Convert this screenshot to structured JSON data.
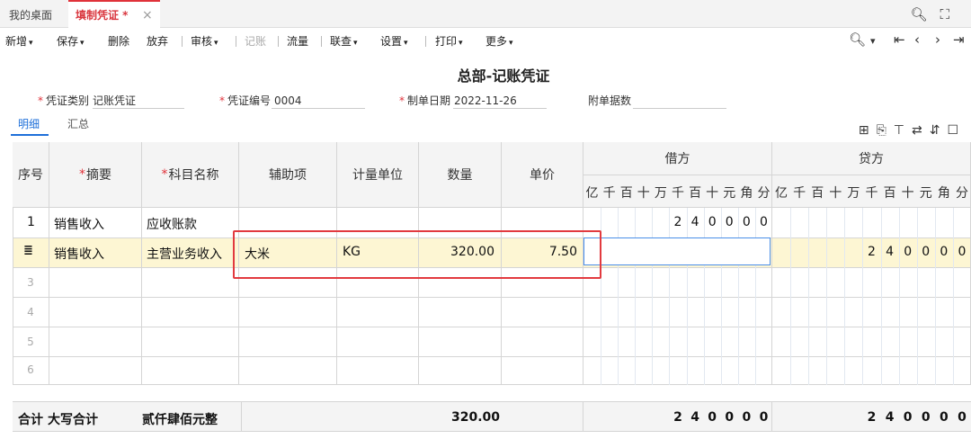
{
  "tabs": {
    "home": "我的桌面",
    "active": "填制凭证 *",
    "close": "×"
  },
  "window_controls": {
    "search": "search-icon",
    "maximize": "maximize-icon"
  },
  "toolbar": {
    "items": [
      {
        "label": "新增",
        "dropdown": true
      },
      {
        "label": "保存",
        "dropdown": true
      },
      {
        "label": "删除",
        "dropdown": false
      },
      {
        "label": "放弃",
        "dropdown": false
      },
      {
        "label": "审核",
        "dropdown": true
      },
      {
        "label": "记账",
        "dropdown": false,
        "disabled": true
      },
      {
        "label": "流量",
        "dropdown": false
      },
      {
        "label": "联查",
        "dropdown": true
      },
      {
        "label": "设置",
        "dropdown": true
      },
      {
        "label": "打印",
        "dropdown": true
      },
      {
        "label": "更多",
        "dropdown": true
      }
    ],
    "caret": "▾"
  },
  "voucher": {
    "title": "总部-记账凭证",
    "type_label": "凭证类别",
    "type_value": "记账凭证",
    "number_label": "凭证编号",
    "number_value": "0004",
    "date_label": "制单日期",
    "date_value": "2022-11-26",
    "attach_label": "附单据数",
    "attach_value": "",
    "required_mark": "*"
  },
  "subtabs": {
    "detail": "明细",
    "summary": "汇总"
  },
  "grid": {
    "headers": {
      "seq": "序号",
      "summary": "摘要",
      "account": "科目名称",
      "aux": "辅助项",
      "unit": "计量单位",
      "qty": "数量",
      "price": "单价",
      "debit": "借方",
      "credit": "贷方"
    },
    "units": [
      "亿",
      "千",
      "百",
      "十",
      "万",
      "千",
      "百",
      "十",
      "元",
      "角",
      "分"
    ],
    "rows": [
      {
        "no": "1",
        "summary": "销售收入",
        "account": "应收账款",
        "aux": "",
        "unit": "",
        "qty": "",
        "price": "",
        "debit_digits": [
          "",
          "",
          "",
          "",
          "",
          "2",
          "4",
          "0",
          "0",
          "0",
          "0"
        ],
        "credit_digits": [
          "",
          "",
          "",
          "",
          "",
          "",
          "",
          "",
          "",
          "",
          ""
        ]
      },
      {
        "no": "",
        "summary": "销售收入",
        "account": "主营业务收入",
        "aux": "大米",
        "unit": "KG",
        "qty": "320.00",
        "price": "7.50",
        "debit_digits": [
          "",
          "",
          "",
          "",
          "",
          "",
          "",
          "",
          "",
          "",
          ""
        ],
        "credit_digits": [
          "",
          "",
          "",
          "",
          "",
          "2",
          "4",
          "0",
          "0",
          "0",
          "0"
        ]
      }
    ],
    "empty_rows": [
      "3",
      "4",
      "5",
      "6"
    ]
  },
  "totals": {
    "label": "合计",
    "upper_label": "大写合计",
    "upper_amount": "贰仟肆佰元整",
    "qty": "320.00",
    "debit_digits": [
      "",
      "",
      "",
      "",
      "",
      "2",
      "4",
      "0",
      "0",
      "0",
      "0"
    ],
    "credit_digits": [
      "",
      "",
      "",
      "",
      "",
      "2",
      "4",
      "0",
      "0",
      "0",
      "0"
    ]
  },
  "colors": {
    "accent": "#1e6fd9",
    "active_tab": "#d9363e",
    "highlight_row": "#fdf6d3",
    "annotation": "#e23a3f"
  }
}
